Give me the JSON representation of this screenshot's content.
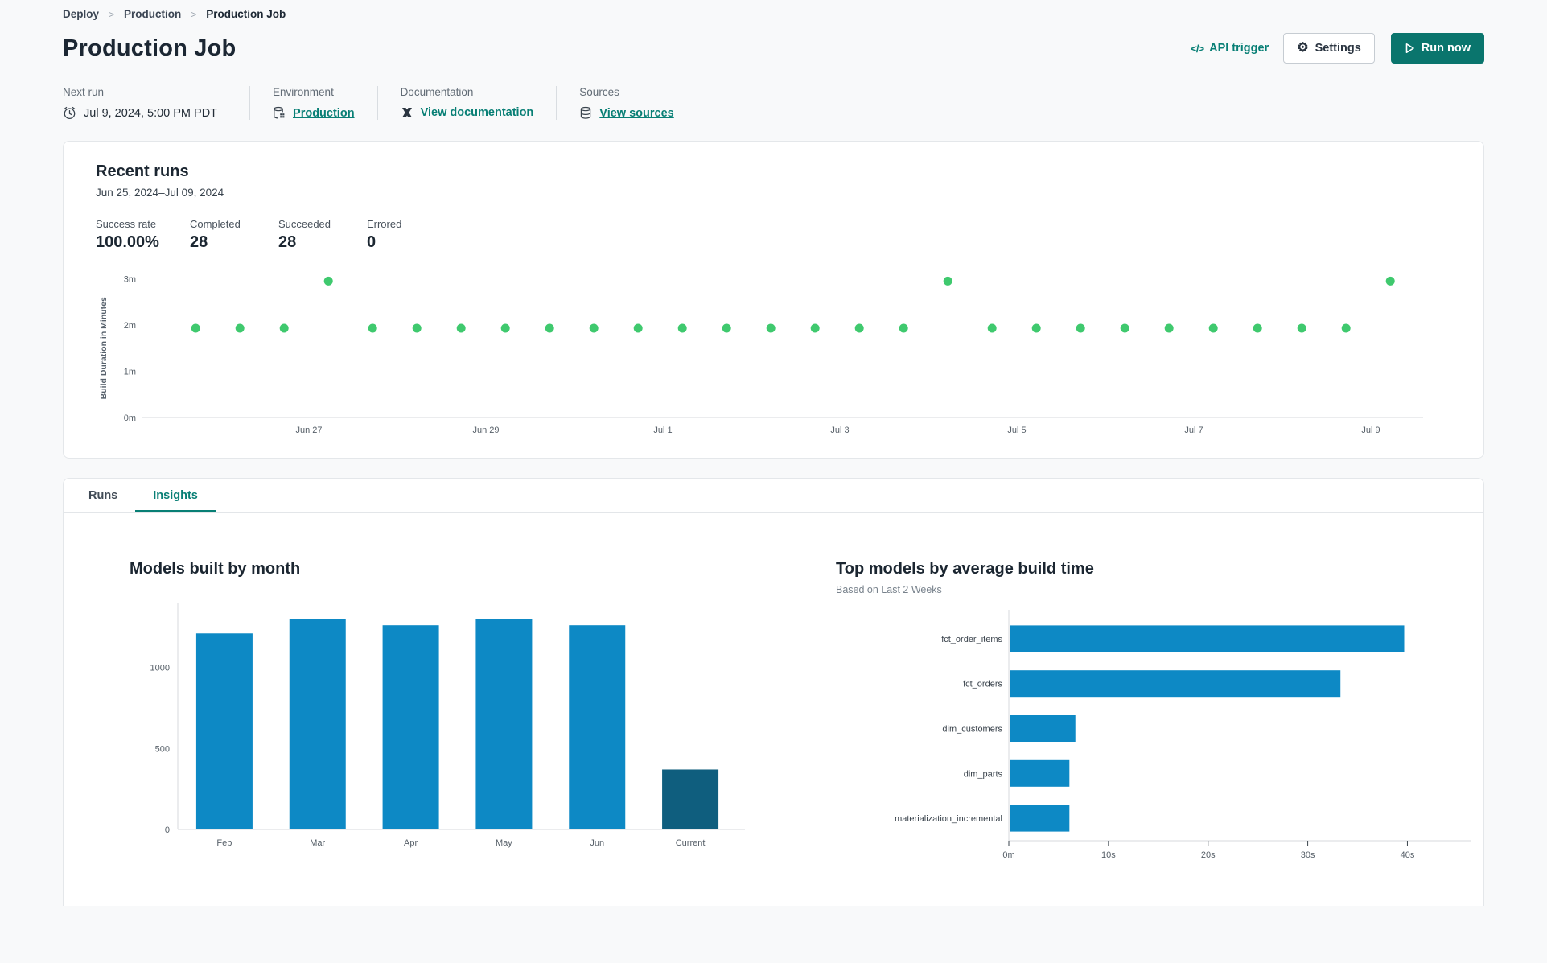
{
  "breadcrumb": {
    "separator": ">",
    "items": [
      "Deploy",
      "Production",
      "Production Job"
    ]
  },
  "header": {
    "title": "Production Job",
    "api_trigger_icon_glyph": "</>",
    "api_trigger_label": "API trigger",
    "settings_icon_glyph": "⚙",
    "settings_label": "Settings",
    "run_now_label": "Run now"
  },
  "meta": {
    "columns": [
      {
        "label": "Next run",
        "value": "Jul 9, 2024, 5:00 PM PDT",
        "icon": "clock-icon"
      },
      {
        "label": "Environment",
        "value": "Production",
        "icon": "environment-database-icon"
      },
      {
        "label": "Documentation",
        "value": "View documentation",
        "icon": "dbt-logo-icon"
      },
      {
        "label": "Sources",
        "value": "View sources",
        "icon": "database-icon"
      }
    ]
  },
  "recent_runs": {
    "title": "Recent runs",
    "date_range": "Jun 25, 2024–Jul 09, 2024",
    "stats": [
      {
        "label": "Success rate",
        "value": "100.00%"
      },
      {
        "label": "Completed",
        "value": "28"
      },
      {
        "label": "Succeeded",
        "value": "28"
      },
      {
        "label": "Errored",
        "value": "0"
      }
    ]
  },
  "tabs": [
    {
      "label": "Runs",
      "active": false
    },
    {
      "label": "Insights",
      "active": true
    }
  ],
  "colors": {
    "accent_teal": "#087f75",
    "run_now_button": "#0a756d",
    "scatter_point_green": "#3fc96e",
    "bar_blue": "#0d89c5",
    "bar_dark_current": "#0f5e7e",
    "axis_line": "#d7dadd",
    "tick_text": "#565f68"
  },
  "chart_data": [
    {
      "id": "build-duration-scatter",
      "type": "scatter",
      "ylabel": "Build Duration in Minutes",
      "y_ticks": [
        {
          "label": "0m",
          "value": 0
        },
        {
          "label": "1m",
          "value": 1
        },
        {
          "label": "2m",
          "value": 2
        },
        {
          "label": "3m",
          "value": 3
        }
      ],
      "x_ticks": [
        {
          "label": "Jun 27",
          "day": 2
        },
        {
          "label": "Jun 29",
          "day": 4
        },
        {
          "label": "Jul 1",
          "day": 6
        },
        {
          "label": "Jul 3",
          "day": 8
        },
        {
          "label": "Jul 5",
          "day": 10
        },
        {
          "label": "Jul 7",
          "day": 12
        },
        {
          "label": "Jul 9",
          "day": 14
        }
      ],
      "xlim_days": [
        0,
        14.55
      ],
      "ylim_minutes": [
        0,
        3.1
      ],
      "points_day_start": 0.72,
      "points_day_step": 0.5,
      "points_minutes": [
        1.93,
        1.93,
        1.93,
        2.95,
        1.93,
        1.93,
        1.93,
        1.93,
        1.93,
        1.93,
        1.93,
        1.93,
        1.93,
        1.93,
        1.93,
        1.93,
        1.93,
        2.95,
        1.93,
        1.93,
        1.93,
        1.93,
        1.93,
        1.93,
        1.93,
        1.93,
        1.93,
        2.95
      ],
      "point_color": "#3fc96e",
      "grid": false
    },
    {
      "id": "models-by-month",
      "type": "bar",
      "title": "Models built by month",
      "categories": [
        "Feb",
        "Mar",
        "Apr",
        "May",
        "Jun",
        "Current"
      ],
      "values": [
        1210,
        1300,
        1260,
        1300,
        1260,
        370
      ],
      "bar_colors": [
        "#0d89c5",
        "#0d89c5",
        "#0d89c5",
        "#0d89c5",
        "#0d89c5",
        "#0f5e7e"
      ],
      "y_ticks": [
        0,
        500,
        1000
      ],
      "ylim": [
        0,
        1400
      ],
      "xlabel": "",
      "ylabel": "",
      "grid": false
    },
    {
      "id": "top-models-by-build-time",
      "type": "bar-horizontal",
      "title": "Top models by average build time",
      "subtitle": "Based on Last 2 Weeks",
      "categories": [
        "fct_order_items",
        "fct_orders",
        "dim_customers",
        "dim_parts",
        "materialization_incremental"
      ],
      "values_seconds": [
        39.6,
        33.2,
        6.6,
        6.0,
        6.0
      ],
      "x_ticks": [
        {
          "label": "0m",
          "value": 0
        },
        {
          "label": "10s",
          "value": 10
        },
        {
          "label": "20s",
          "value": 20
        },
        {
          "label": "30s",
          "value": 30
        },
        {
          "label": "40s",
          "value": 40
        }
      ],
      "xlim_seconds": [
        0,
        44
      ],
      "bar_color": "#0d89c5",
      "grid": false
    }
  ]
}
